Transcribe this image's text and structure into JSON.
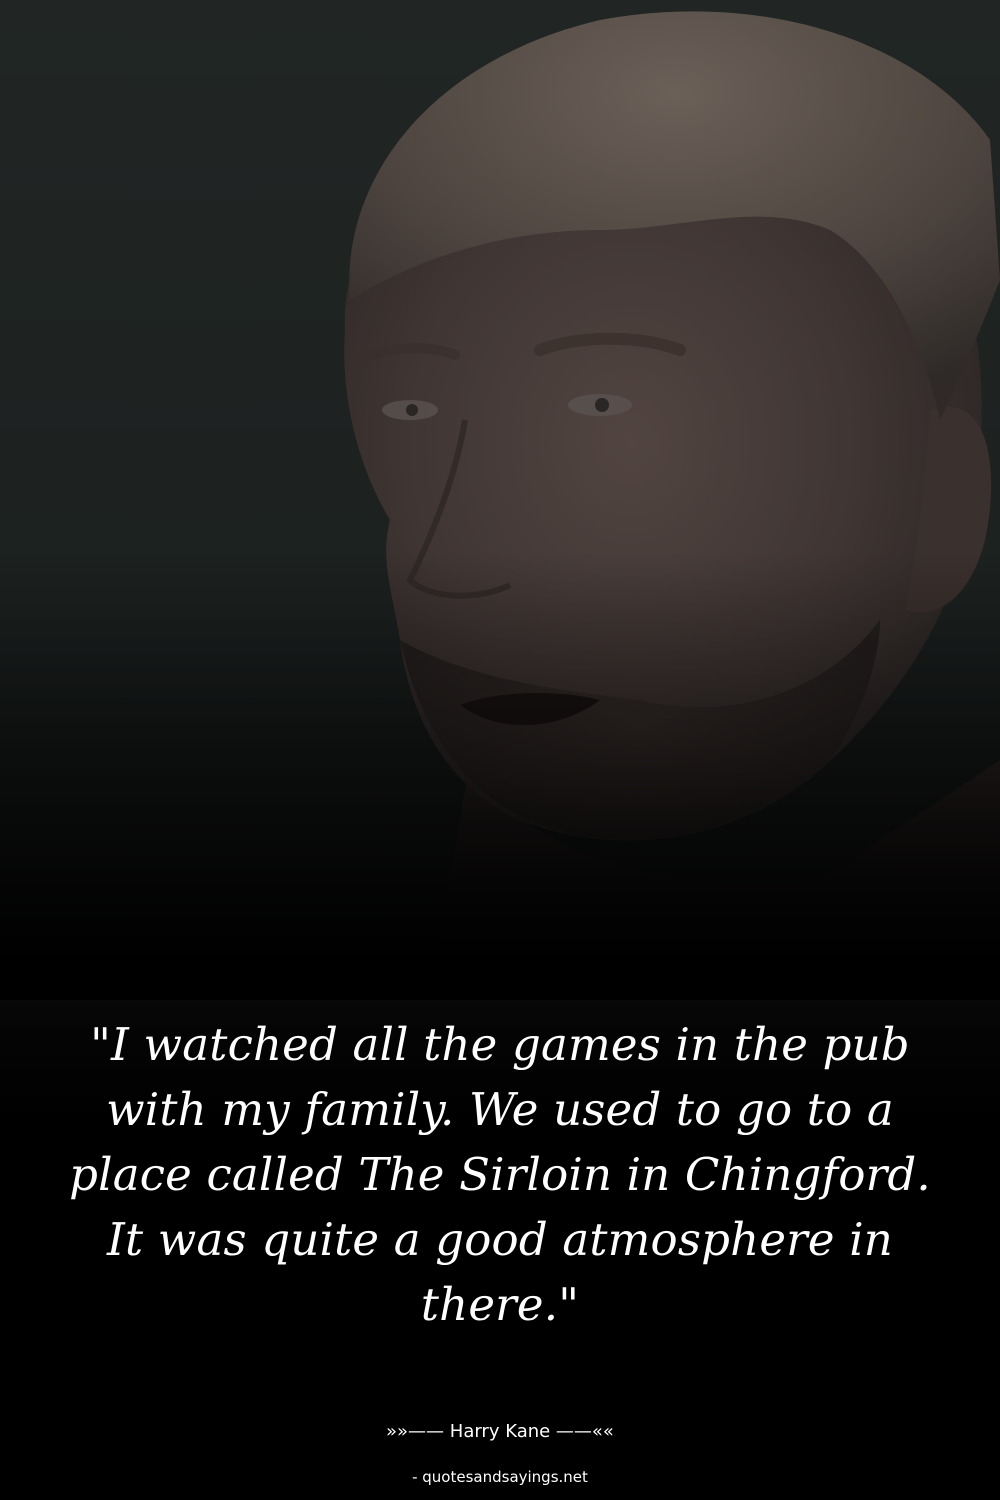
{
  "quote": {
    "text": "\"I watched all the games in the pub with my family. We used to go to a place called The Sirloin in Chingford. It was quite a good atmosphere in there.\""
  },
  "author": {
    "line": "»»—— Harry Kane ——««"
  },
  "source": {
    "line": "- quotesandsayings.net"
  },
  "photo": {
    "subject": "portrait of a man with light swept-back hair and short beard",
    "colors": {
      "background": "#1f2423",
      "skin": "#4a3f3b",
      "hair": "#5c534c"
    }
  }
}
